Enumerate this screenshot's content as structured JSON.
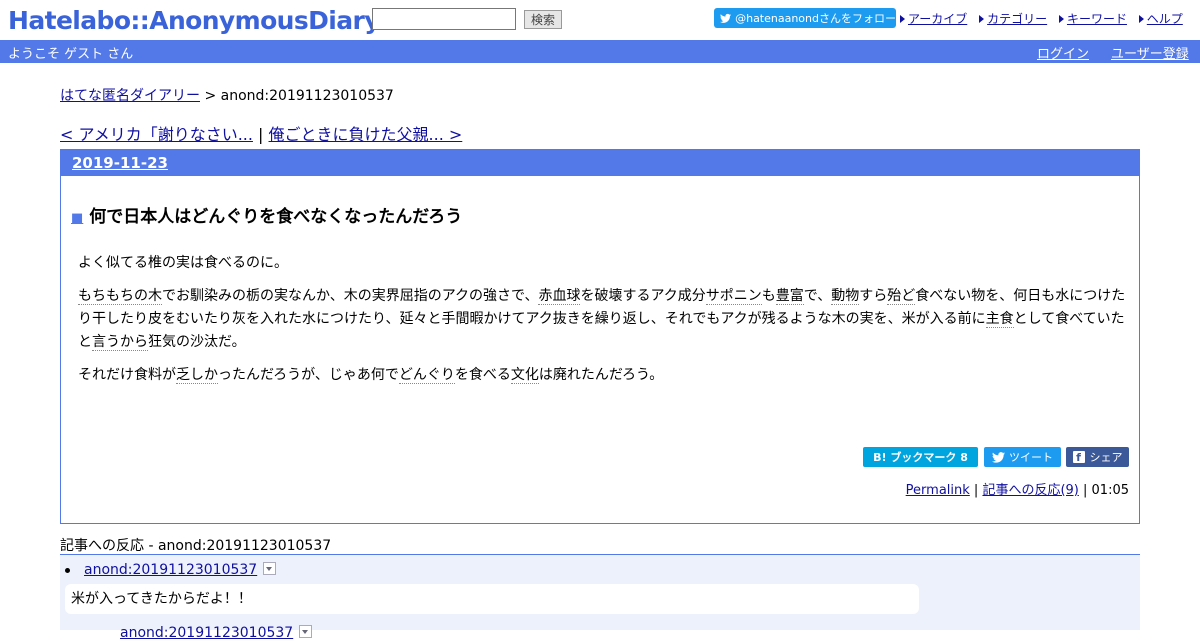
{
  "header": {
    "logo": "Hatelabo::AnonymousDiary",
    "search_value": "",
    "search_button": "検索",
    "twitter_follow": "@hatenaanondさんをフォロー",
    "nav": [
      "アーカイブ",
      "カテゴリー",
      "キーワード",
      "ヘルプ"
    ]
  },
  "bar": {
    "welcome": "ようこそ ゲスト さん",
    "login": "ログイン",
    "register": "ユーザー登録"
  },
  "breadcrumb": {
    "home": "はてな匿名ダイアリー",
    "sep": " > ",
    "current": "anond:20191123010537"
  },
  "prevnext": {
    "prev": "< アメリカ「謝りなさい...",
    "sep": " | ",
    "next": "俺ごときに負けた父親... >"
  },
  "entry": {
    "date": "2019-11-23",
    "square": "■",
    "title": "何で日本人はどんぐりを食べなくなったんだろう",
    "p1": "よく似てる椎の実は食べるのに。",
    "p2": [
      {
        "t": "もちもちの木",
        "kw": true
      },
      {
        "t": "でお馴染みの栃の実なんか、木の実界屈指のアクの強さで、",
        "kw": false
      },
      {
        "t": "赤血球",
        "kw": true
      },
      {
        "t": "を破壊するアク成分",
        "kw": false
      },
      {
        "t": "サポニン",
        "kw": true
      },
      {
        "t": "も",
        "kw": false
      },
      {
        "t": "豊富",
        "kw": true
      },
      {
        "t": "で、",
        "kw": false
      },
      {
        "t": "動物",
        "kw": true
      },
      {
        "t": "すら",
        "kw": false
      },
      {
        "t": "殆ど",
        "kw": true
      },
      {
        "t": "食べない物を、何日も水につけたり干したり皮をむいたり灰を入れた水につけたり、延々と手間暇かけてアク抜きを繰り返し、それでもアクが残るような木の実を、米が入る前に",
        "kw": false
      },
      {
        "t": "主食",
        "kw": true
      },
      {
        "t": "として食べていたと",
        "kw": false
      },
      {
        "t": "言うから",
        "kw": true
      },
      {
        "t": "狂気の沙汰だ。",
        "kw": false
      }
    ],
    "p3": [
      {
        "t": "それだけ食料が",
        "kw": false
      },
      {
        "t": "乏しか",
        "kw": true
      },
      {
        "t": "ったんだろうが、じゃあ何で",
        "kw": false
      },
      {
        "t": "どんぐり",
        "kw": true
      },
      {
        "t": "を食べる",
        "kw": false
      },
      {
        "t": "文化",
        "kw": true
      },
      {
        "t": "は廃れたんだろう。",
        "kw": false
      }
    ],
    "share_hatebu": "B! ブックマーク  8",
    "share_tweet": "ツイート",
    "share_fb": "シェア",
    "permalink": "Permalink",
    "meta_sep": " | ",
    "reactions_link": "記事への反応(9)",
    "time": "01:05"
  },
  "reactions": {
    "title": "記事への反応 - anond:20191123010537",
    "item1_link": "anond:20191123010537",
    "item1_text": "米が入ってきたからだよ！！",
    "item2_link": "anond:20191123010537"
  },
  "colors": {
    "accent": "#5279e7",
    "link": "#1010a0",
    "react_bg": "#edf1fb"
  }
}
